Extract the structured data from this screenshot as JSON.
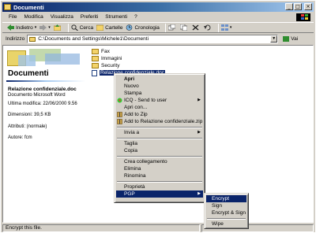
{
  "window": {
    "title": "Documenti",
    "buttons": [
      "_",
      "□",
      "×"
    ]
  },
  "menubar": [
    "File",
    "Modifica",
    "Visualizza",
    "Preferiti",
    "Strumenti",
    "?"
  ],
  "toolbar": {
    "back": "Indietro",
    "search": "Cerca",
    "folders": "Cartelle",
    "history": "Cronologia"
  },
  "address": {
    "label": "Indirizzo",
    "value": "C:\\Documents and Settings\\Michele1\\Documenti",
    "go": "Vai"
  },
  "left_pane": {
    "title": "Documenti",
    "file_name": "Relazione confidenziale.doc",
    "file_type": "Documento Microsoft Word",
    "modified": "Ultima modifica: 22/06/2000 9.56",
    "size": "Dimensioni: 39,5 KB",
    "attributes": "Attributi: (normale)",
    "author": "Autore: fcm"
  },
  "files": [
    {
      "name": "Fax",
      "icon": "folder-icon"
    },
    {
      "name": "Immagini",
      "icon": "folder-icon"
    },
    {
      "name": "Security",
      "icon": "folder-icon"
    },
    {
      "name": "Relazione confidenziale.doc",
      "icon": "word-document-icon"
    }
  ],
  "context_menu": {
    "open": "Apri",
    "new": "Nuovo",
    "print": "Stampa",
    "icq": "ICQ - Send to user",
    "open_with": "Apri con...",
    "add_zip": "Add to Zip",
    "add_named_zip": "Add to Relazione confidenziale.zip",
    "send_to": "Invia a",
    "cut": "Taglia",
    "copy": "Copia",
    "create_link": "Crea collegamento",
    "delete": "Elimina",
    "rename": "Rinomina",
    "properties": "Proprietà",
    "pgp": "PGP"
  },
  "pgp_submenu": [
    "Encrypt",
    "Sign",
    "Encrypt & Sign",
    "Wipe"
  ],
  "status": {
    "text": "Encrypt this file."
  },
  "colors": {
    "selection": "#0a246a",
    "titlebar": "#0a246a",
    "face": "#d4d0c8"
  }
}
